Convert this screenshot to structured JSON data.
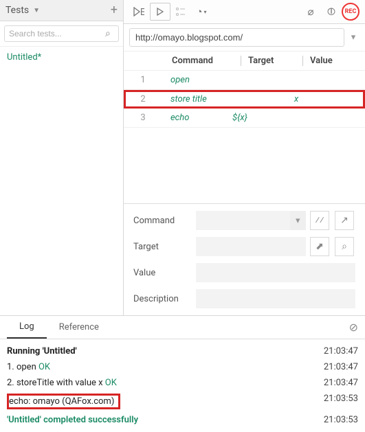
{
  "sidebar": {
    "title": "Tests",
    "search_placeholder": "Search tests...",
    "tests": [
      "Untitled*"
    ]
  },
  "toolbar": {
    "run_all_icon": "▷:",
    "run_icon": "▷",
    "step_icon": "⧉",
    "speed_icon": "◔",
    "disable_bp_icon": "⌀",
    "pause_icon": "⏸",
    "rec_label": "REC"
  },
  "url": "http://omayo.blogspot.com/",
  "table": {
    "headers": {
      "command": "Command",
      "target": "Target",
      "value": "Value"
    },
    "rows": [
      {
        "n": "1",
        "command": "open",
        "target": "",
        "value": ""
      },
      {
        "n": "2",
        "command": "store title",
        "target": "",
        "value": "x",
        "selected": true
      },
      {
        "n": "3",
        "command": "echo",
        "target": "${x}",
        "value": ""
      }
    ]
  },
  "form": {
    "command_label": "Command",
    "target_label": "Target",
    "value_label": "Value",
    "description_label": "Description",
    "command": "",
    "target": "",
    "value": "",
    "description": ""
  },
  "log_tabs": {
    "log": "Log",
    "reference": "Reference"
  },
  "log": {
    "running": "Running 'Untitled'",
    "lines": [
      {
        "pre": "1.  open ",
        "ok": "OK",
        "ts": "21:03:47"
      },
      {
        "pre": "2.  storeTitle with value x ",
        "ok": "OK",
        "ts": "21:03:47"
      }
    ],
    "echo": "echo: omayo (QAFox.com)",
    "echo_ts": "21:03:53",
    "success": "'Untitled' completed successfully",
    "success_ts": "21:03:53",
    "running_ts": "21:03:47"
  }
}
